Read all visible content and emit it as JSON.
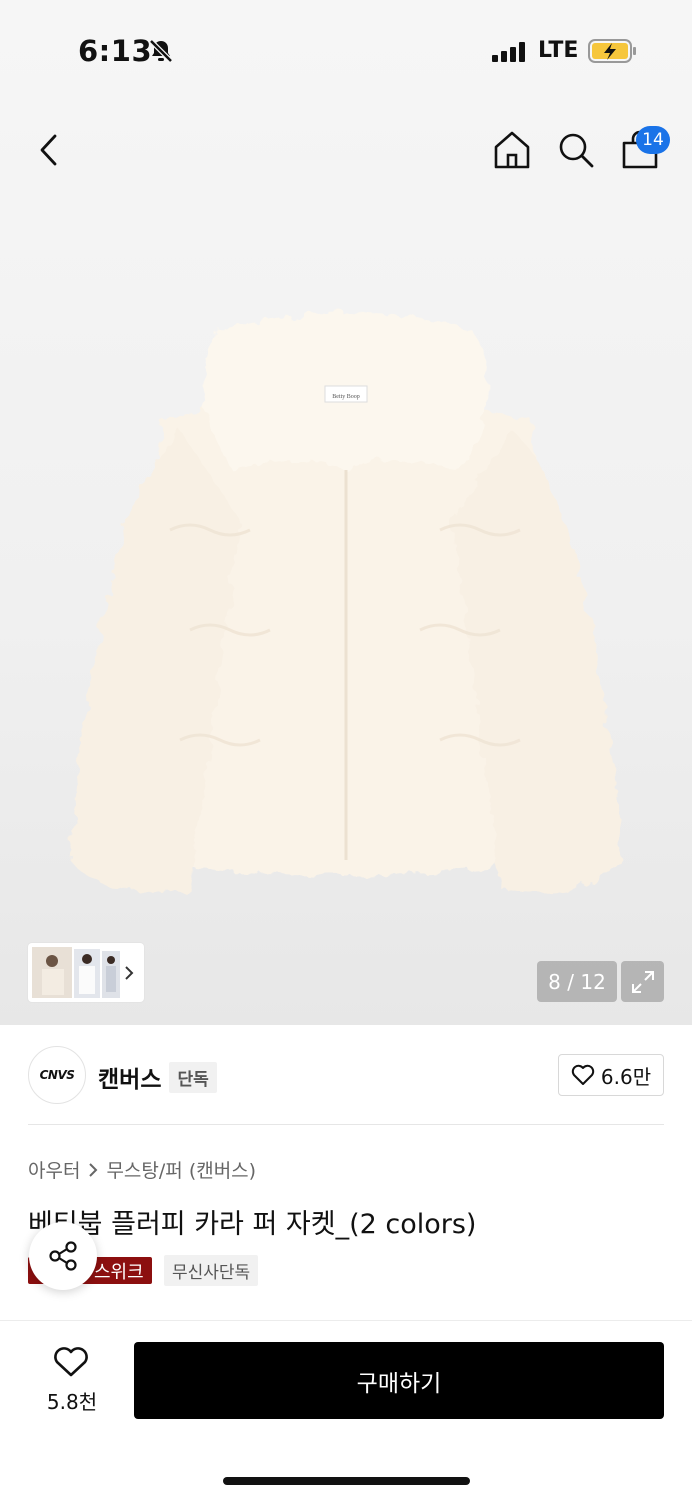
{
  "status_bar": {
    "time": "6:13",
    "network": "LTE"
  },
  "header": {
    "cart_count": "14"
  },
  "gallery": {
    "counter": "8 / 12"
  },
  "brand": {
    "logo_text": "CNVS",
    "name": "캔버스",
    "exclusive_tag": "단독",
    "like_count": "6.6만"
  },
  "product": {
    "breadcrumb": [
      "아우터",
      "무스탕/퍼 (캔버스)"
    ],
    "title": "베티붑 플러피 카라 퍼 자켓_(2 colors)",
    "tag_red": "스위크",
    "tag_grey": "무신사단독"
  },
  "bottom_bar": {
    "wish_count": "5.8천",
    "buy_label": "구매하기"
  },
  "colors": {
    "buy": "#000000",
    "badge": "#1a73e8",
    "tag_red": "#8c0f0f"
  }
}
